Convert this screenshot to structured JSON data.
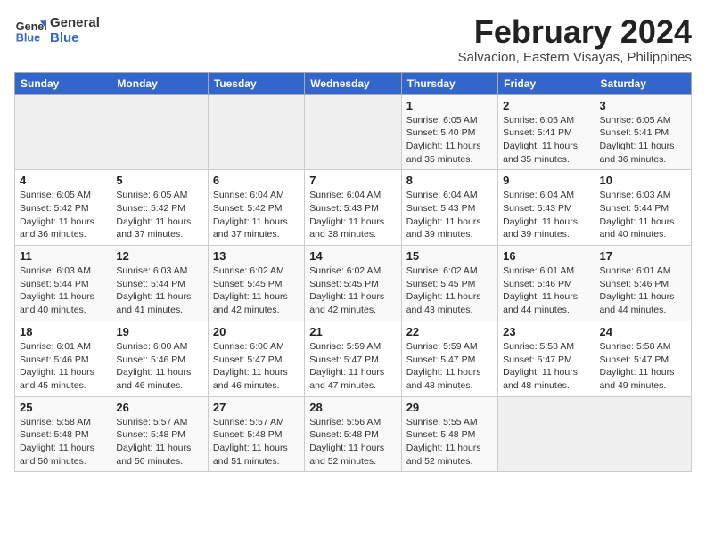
{
  "logo": {
    "line1": "General",
    "line2": "Blue"
  },
  "title": "February 2024",
  "subtitle": "Salvacion, Eastern Visayas, Philippines",
  "days_of_week": [
    "Sunday",
    "Monday",
    "Tuesday",
    "Wednesday",
    "Thursday",
    "Friday",
    "Saturday"
  ],
  "weeks": [
    [
      {
        "day": "",
        "info": ""
      },
      {
        "day": "",
        "info": ""
      },
      {
        "day": "",
        "info": ""
      },
      {
        "day": "",
        "info": ""
      },
      {
        "day": "1",
        "info": "Sunrise: 6:05 AM\nSunset: 5:40 PM\nDaylight: 11 hours and 35 minutes."
      },
      {
        "day": "2",
        "info": "Sunrise: 6:05 AM\nSunset: 5:41 PM\nDaylight: 11 hours and 35 minutes."
      },
      {
        "day": "3",
        "info": "Sunrise: 6:05 AM\nSunset: 5:41 PM\nDaylight: 11 hours and 36 minutes."
      }
    ],
    [
      {
        "day": "4",
        "info": "Sunrise: 6:05 AM\nSunset: 5:42 PM\nDaylight: 11 hours and 36 minutes."
      },
      {
        "day": "5",
        "info": "Sunrise: 6:05 AM\nSunset: 5:42 PM\nDaylight: 11 hours and 37 minutes."
      },
      {
        "day": "6",
        "info": "Sunrise: 6:04 AM\nSunset: 5:42 PM\nDaylight: 11 hours and 37 minutes."
      },
      {
        "day": "7",
        "info": "Sunrise: 6:04 AM\nSunset: 5:43 PM\nDaylight: 11 hours and 38 minutes."
      },
      {
        "day": "8",
        "info": "Sunrise: 6:04 AM\nSunset: 5:43 PM\nDaylight: 11 hours and 39 minutes."
      },
      {
        "day": "9",
        "info": "Sunrise: 6:04 AM\nSunset: 5:43 PM\nDaylight: 11 hours and 39 minutes."
      },
      {
        "day": "10",
        "info": "Sunrise: 6:03 AM\nSunset: 5:44 PM\nDaylight: 11 hours and 40 minutes."
      }
    ],
    [
      {
        "day": "11",
        "info": "Sunrise: 6:03 AM\nSunset: 5:44 PM\nDaylight: 11 hours and 40 minutes."
      },
      {
        "day": "12",
        "info": "Sunrise: 6:03 AM\nSunset: 5:44 PM\nDaylight: 11 hours and 41 minutes."
      },
      {
        "day": "13",
        "info": "Sunrise: 6:02 AM\nSunset: 5:45 PM\nDaylight: 11 hours and 42 minutes."
      },
      {
        "day": "14",
        "info": "Sunrise: 6:02 AM\nSunset: 5:45 PM\nDaylight: 11 hours and 42 minutes."
      },
      {
        "day": "15",
        "info": "Sunrise: 6:02 AM\nSunset: 5:45 PM\nDaylight: 11 hours and 43 minutes."
      },
      {
        "day": "16",
        "info": "Sunrise: 6:01 AM\nSunset: 5:46 PM\nDaylight: 11 hours and 44 minutes."
      },
      {
        "day": "17",
        "info": "Sunrise: 6:01 AM\nSunset: 5:46 PM\nDaylight: 11 hours and 44 minutes."
      }
    ],
    [
      {
        "day": "18",
        "info": "Sunrise: 6:01 AM\nSunset: 5:46 PM\nDaylight: 11 hours and 45 minutes."
      },
      {
        "day": "19",
        "info": "Sunrise: 6:00 AM\nSunset: 5:46 PM\nDaylight: 11 hours and 46 minutes."
      },
      {
        "day": "20",
        "info": "Sunrise: 6:00 AM\nSunset: 5:47 PM\nDaylight: 11 hours and 46 minutes."
      },
      {
        "day": "21",
        "info": "Sunrise: 5:59 AM\nSunset: 5:47 PM\nDaylight: 11 hours and 47 minutes."
      },
      {
        "day": "22",
        "info": "Sunrise: 5:59 AM\nSunset: 5:47 PM\nDaylight: 11 hours and 48 minutes."
      },
      {
        "day": "23",
        "info": "Sunrise: 5:58 AM\nSunset: 5:47 PM\nDaylight: 11 hours and 48 minutes."
      },
      {
        "day": "24",
        "info": "Sunrise: 5:58 AM\nSunset: 5:47 PM\nDaylight: 11 hours and 49 minutes."
      }
    ],
    [
      {
        "day": "25",
        "info": "Sunrise: 5:58 AM\nSunset: 5:48 PM\nDaylight: 11 hours and 50 minutes."
      },
      {
        "day": "26",
        "info": "Sunrise: 5:57 AM\nSunset: 5:48 PM\nDaylight: 11 hours and 50 minutes."
      },
      {
        "day": "27",
        "info": "Sunrise: 5:57 AM\nSunset: 5:48 PM\nDaylight: 11 hours and 51 minutes."
      },
      {
        "day": "28",
        "info": "Sunrise: 5:56 AM\nSunset: 5:48 PM\nDaylight: 11 hours and 52 minutes."
      },
      {
        "day": "29",
        "info": "Sunrise: 5:55 AM\nSunset: 5:48 PM\nDaylight: 11 hours and 52 minutes."
      },
      {
        "day": "",
        "info": ""
      },
      {
        "day": "",
        "info": ""
      }
    ]
  ]
}
